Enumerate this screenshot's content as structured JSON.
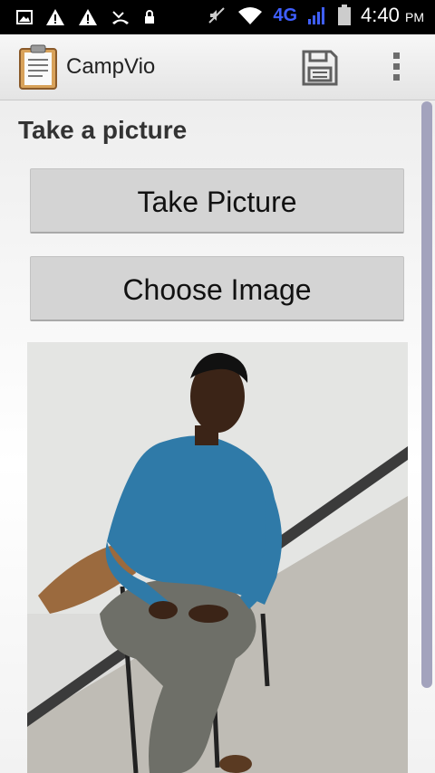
{
  "status_bar": {
    "network": "4G",
    "time": "4:40",
    "ampm": "PM"
  },
  "app_bar": {
    "title": "CampVio"
  },
  "content": {
    "section_title": "Take a picture",
    "take_picture_label": "Take Picture",
    "choose_image_label": "Choose Image"
  },
  "icons": [
    "gallery-icon",
    "warning-icon",
    "warning-icon",
    "missed-call-icon",
    "lock-icon",
    "mute-icon",
    "wifi-icon",
    "signal-icon",
    "battery-icon",
    "clipboard-icon",
    "save-icon",
    "overflow-menu-icon"
  ],
  "colors": {
    "status_bar_bg": "#000000",
    "app_bar_bg": "#eeeeee",
    "button_bg": "#d4d4d4",
    "scrollbar": "#a3a3bd",
    "network_accent": "#3f5fff"
  }
}
